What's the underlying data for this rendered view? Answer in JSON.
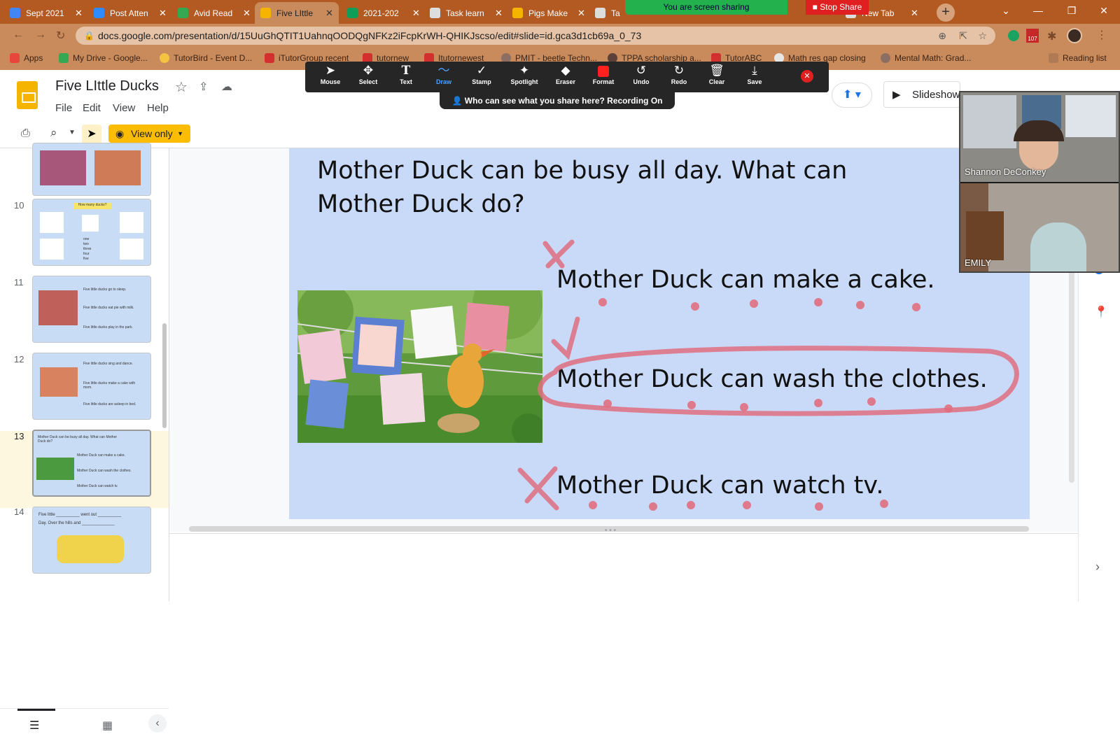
{
  "browser": {
    "tabs": [
      {
        "title": "Sept 2021",
        "color": "#4285f4"
      },
      {
        "title": "Post Atten",
        "color": "#2d8cff"
      },
      {
        "title": "Avid Read",
        "color": "#34a853"
      },
      {
        "title": "Five LIttle",
        "color": "#f4b400"
      },
      {
        "title": "2021-202",
        "color": "#0f9d58"
      },
      {
        "title": "Task learn",
        "color": "#cccccc"
      },
      {
        "title": "Pigs Make",
        "color": "#f4b400"
      },
      {
        "title": "Ta",
        "color": "#cccccc"
      },
      {
        "title": "New Tab",
        "color": "#cccccc"
      }
    ],
    "url": "docs.google.com/presentation/d/15UuGhQTIT1UahnqOODQgNFKz2iFcpKrWH-QHIKJscso/edit#slide=id.gca3d1cb69a_0_73",
    "bookmarks": [
      "Apps",
      "My Drive - Google...",
      "TutorBird - Event D...",
      "iTutorGroup recent",
      "tutornew",
      "Itutornewest",
      "PMIT - beetle Techn...",
      "TPPA scholarship a...",
      "TutorABC",
      "Math res gap closing",
      "Mental Math: Grad...",
      "Reading list"
    ],
    "badge": "107"
  },
  "share": {
    "sharing_text": "You are screen sharing",
    "stop_label": "Stop Share",
    "who_can_see": "Who can see what you share here? Recording On",
    "tools": [
      "Mouse",
      "Select",
      "Text",
      "Draw",
      "Stamp",
      "Spotlight",
      "Eraser",
      "Format",
      "Undo",
      "Redo",
      "Clear",
      "Save"
    ]
  },
  "doc": {
    "title": "Five LIttle Ducks",
    "menus": [
      "File",
      "Edit",
      "View",
      "Help"
    ],
    "view_only": "View only",
    "slideshow": "Slideshow"
  },
  "filmstrip": {
    "numbers": [
      "10",
      "11",
      "12",
      "13",
      "14"
    ],
    "t10_title": "How many ducks?",
    "t10_words": [
      "one",
      "two",
      "three",
      "four",
      "five"
    ],
    "t11": [
      "Five little ducks go to sleep.",
      "Five little ducks eat pie with milk.",
      "Five little ducks play in the park."
    ],
    "t12": [
      "Five little ducks sing and dance.",
      "Five little ducks make a cake with mom.",
      "Five little ducks are asleep in bed."
    ],
    "t13": [
      "Mother Duck can be busy all day. What can Mother Duck do?",
      "Mother Duck can make a cake.",
      "Mother Duck can wash the clothes.",
      "Mother Duck can watch tv."
    ],
    "t14": [
      "Five little __________ went out __________",
      "Day. Over the hills and ______________"
    ]
  },
  "slide": {
    "question_line1": "Mother Duck can be busy all day. What can",
    "question_line2": "Mother Duck do?",
    "option1": "Mother Duck can make a cake.",
    "option2": "Mother Duck can wash the clothes.",
    "option3": "Mother Duck can watch tv."
  },
  "video": {
    "participant1": "Shannon DeConkey",
    "participant2": "EMILY"
  },
  "colors": {
    "ink": "#e06f80",
    "slide_bg": "#c9daf8",
    "view_only_bg": "#fbbc04"
  }
}
